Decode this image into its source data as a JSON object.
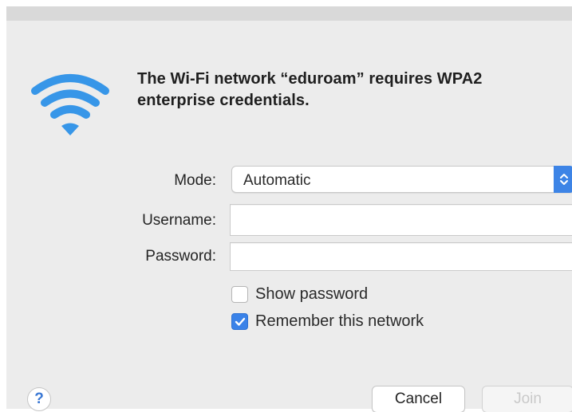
{
  "dialog": {
    "message": "The Wi-Fi network “eduroam” requires WPA2 enterprise credentials.",
    "icon": "wifi-icon"
  },
  "form": {
    "mode": {
      "label": "Mode:",
      "selected": "Automatic"
    },
    "username": {
      "label": "Username:",
      "value": ""
    },
    "password": {
      "label": "Password:",
      "value": ""
    },
    "show_password": {
      "label": "Show password",
      "checked": false
    },
    "remember_network": {
      "label": "Remember this network",
      "checked": true
    }
  },
  "buttons": {
    "help": "?",
    "cancel": "Cancel",
    "join": "Join"
  },
  "colors": {
    "accent": "#3a82e8",
    "wifi": "#3796e8",
    "dialog_background": "#ececec"
  }
}
